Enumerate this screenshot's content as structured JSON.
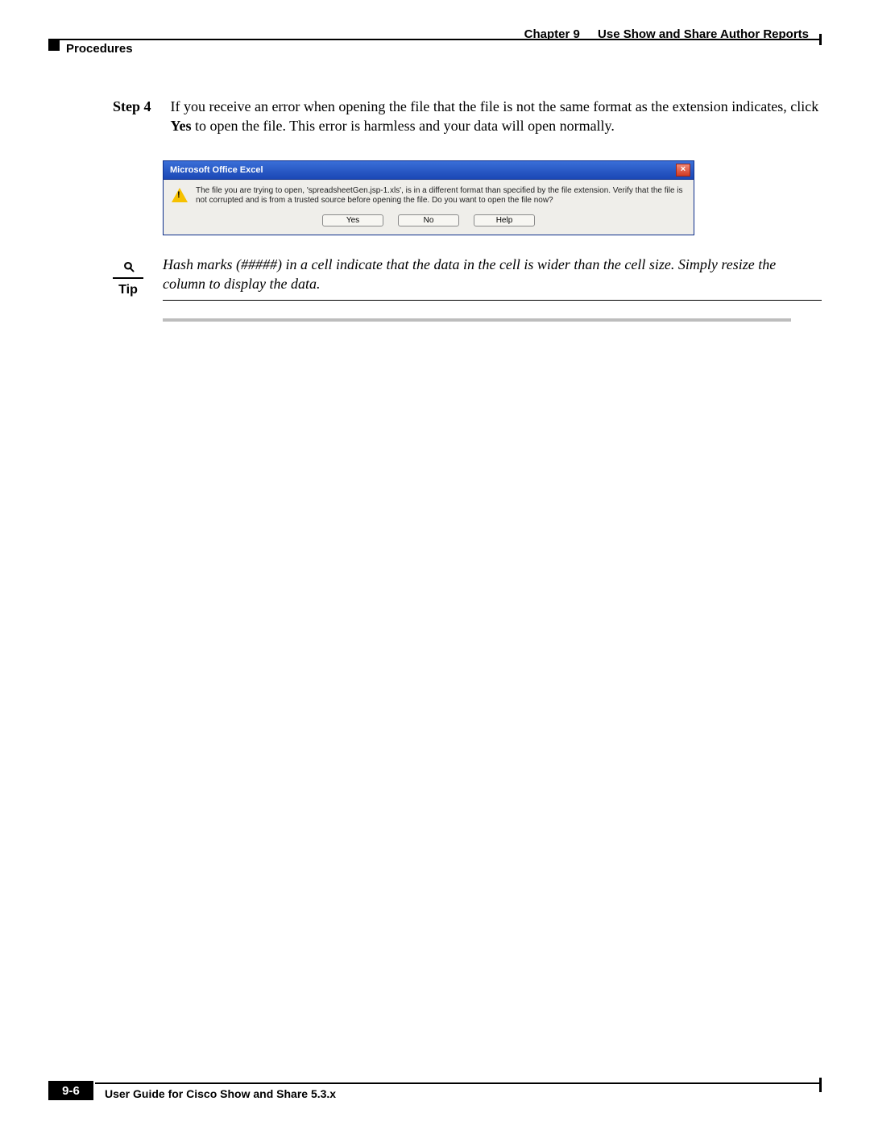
{
  "header": {
    "chapter_label": "Chapter 9",
    "chapter_title": "Use Show and Share Author Reports",
    "section": "Procedures"
  },
  "step": {
    "label": "Step 4",
    "text_before_bold": "If you receive an error when opening the file that the file is not the same format as the extension indicates, click ",
    "bold_word": "Yes",
    "text_after_bold": " to open the file. This error is harmless and your data will open normally."
  },
  "dialog": {
    "title": "Microsoft Office Excel",
    "close_glyph": "×",
    "message": "The file you are trying to open, 'spreadsheetGen.jsp-1.xls', is in a different format than specified by the file extension. Verify that the file is not corrupted and is from a trusted source before opening the file. Do you want to open the file now?",
    "buttons": {
      "yes": "Yes",
      "no": "No",
      "help": "Help"
    }
  },
  "tip": {
    "icon_glyph": "⌕",
    "label": "Tip",
    "text": "Hash marks (#####) in a cell indicate that the data in the cell is wider than the cell size. Simply resize the column to display the data."
  },
  "footer": {
    "guide_title": "User Guide for Cisco Show and Share 5.3.x",
    "page": "9-6"
  }
}
